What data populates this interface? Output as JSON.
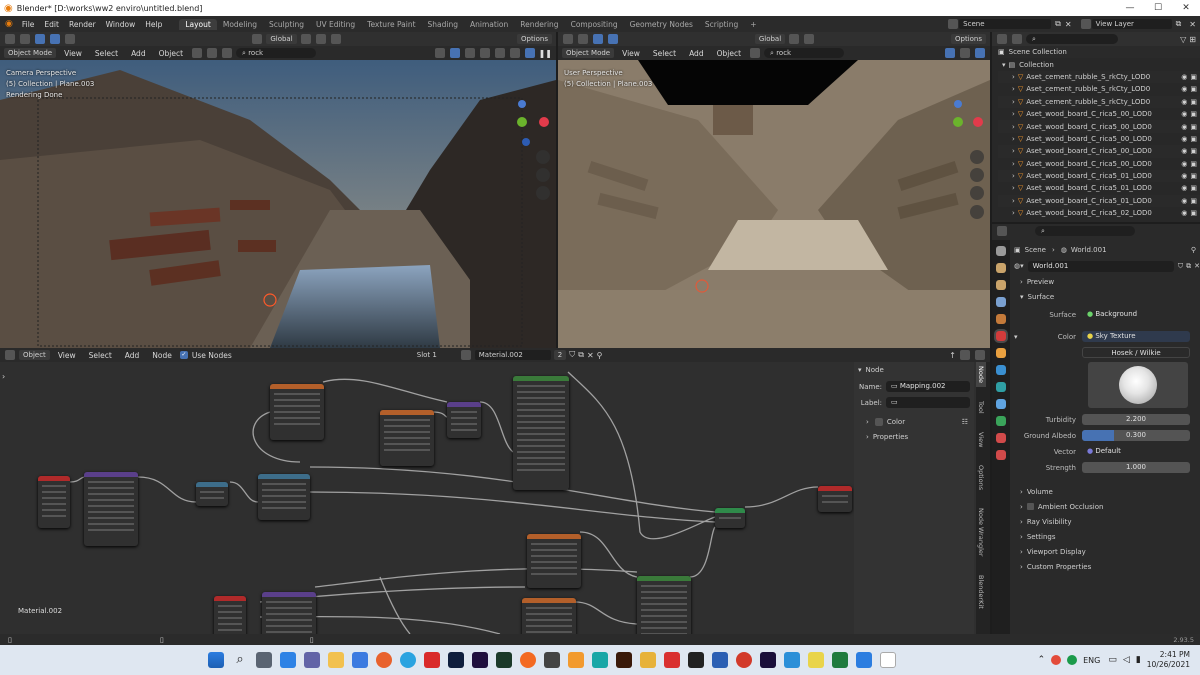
{
  "window": {
    "title": "Blender* [D:\\works\\ww2 enviro\\untitled.blend]"
  },
  "menu": [
    "File",
    "Edit",
    "Render",
    "Window",
    "Help"
  ],
  "workspaces": [
    "Layout",
    "Modeling",
    "Sculpting",
    "UV Editing",
    "Texture Paint",
    "Shading",
    "Animation",
    "Rendering",
    "Compositing",
    "Geometry Nodes",
    "Scripting"
  ],
  "scene_field": "Scene",
  "view_layer_field": "View Layer",
  "left_viewport": {
    "mode": "Object Mode",
    "menus": [
      "View",
      "Select",
      "Add",
      "Object"
    ],
    "transform": "Global",
    "search": "rock",
    "options": "Options",
    "info": [
      "Camera Perspective",
      "(5) Collection | Plane.003",
      "Rendering Done"
    ]
  },
  "right_viewport": {
    "mode": "Object Mode",
    "menus": [
      "View",
      "Select",
      "Add",
      "Object"
    ],
    "transform": "Global",
    "search": "rock",
    "options": "Options",
    "info": [
      "User Perspective",
      "(5) Collection | Plane.003"
    ]
  },
  "outliner": {
    "root": "Scene Collection",
    "collection": "Collection",
    "items": [
      "Aset_cement_rubble_S_rkCty_LOD0",
      "Aset_cement_rubble_S_rkCty_LOD0",
      "Aset_cement_rubble_S_rkCty_LOD0",
      "Aset_wood_board_C_rica5_00_LOD0",
      "Aset_wood_board_C_rica5_00_LOD0",
      "Aset_wood_board_C_rica5_00_LOD0",
      "Aset_wood_board_C_rica5_00_LOD0",
      "Aset_wood_board_C_rica5_00_LOD0",
      "Aset_wood_board_C_rica5_01_LOD0",
      "Aset_wood_board_C_rica5_01_LOD0",
      "Aset_wood_board_C_rica5_01_LOD0",
      "Aset_wood_board_C_rica5_02_LOD0"
    ]
  },
  "properties": {
    "breadcrumb_scene": "Scene",
    "breadcrumb_world": "World.001",
    "world_name": "World.001",
    "panels_top": [
      "Preview",
      "Surface"
    ],
    "surface": "Background",
    "color": "Sky Texture",
    "sky_type": "Hosek / Wilkie",
    "turbidity_label": "Turbidity",
    "turbidity": "2.200",
    "albedo_label": "Ground Albedo",
    "albedo": "0.300",
    "albedo_fraction": 0.3,
    "vector_label": "Vector",
    "vector": "Default",
    "strength_label": "Strength",
    "strength": "1.000",
    "surface_label": "Surface",
    "color_label": "Color",
    "panels_bottom": [
      "Volume",
      "Ambient Occlusion",
      "Ray Visibility",
      "Settings",
      "Viewport Display",
      "Custom Properties"
    ]
  },
  "node_editor": {
    "type": "Object",
    "menus": [
      "View",
      "Select",
      "Add",
      "Node"
    ],
    "use_nodes": "Use Nodes",
    "slot": "Slot 1",
    "material": "Material.002",
    "users": "2",
    "material_label": "Material.002"
  },
  "node_sidebar": {
    "section": "Node",
    "name_label": "Name:",
    "name_value": "Mapping.002",
    "label_label": "Label:",
    "color": "Color",
    "properties": "Properties",
    "tabs": [
      "Node",
      "Tool",
      "View",
      "Options",
      "Node Wrangler",
      "BlenderKit"
    ]
  },
  "status": {
    "version": "2.93.5"
  },
  "taskbar": {
    "language": "ENG",
    "time": "2:41 PM",
    "date": "10/26/2021"
  },
  "colors": {
    "accent": "#4772b3",
    "orange": "#ff9c2a"
  }
}
